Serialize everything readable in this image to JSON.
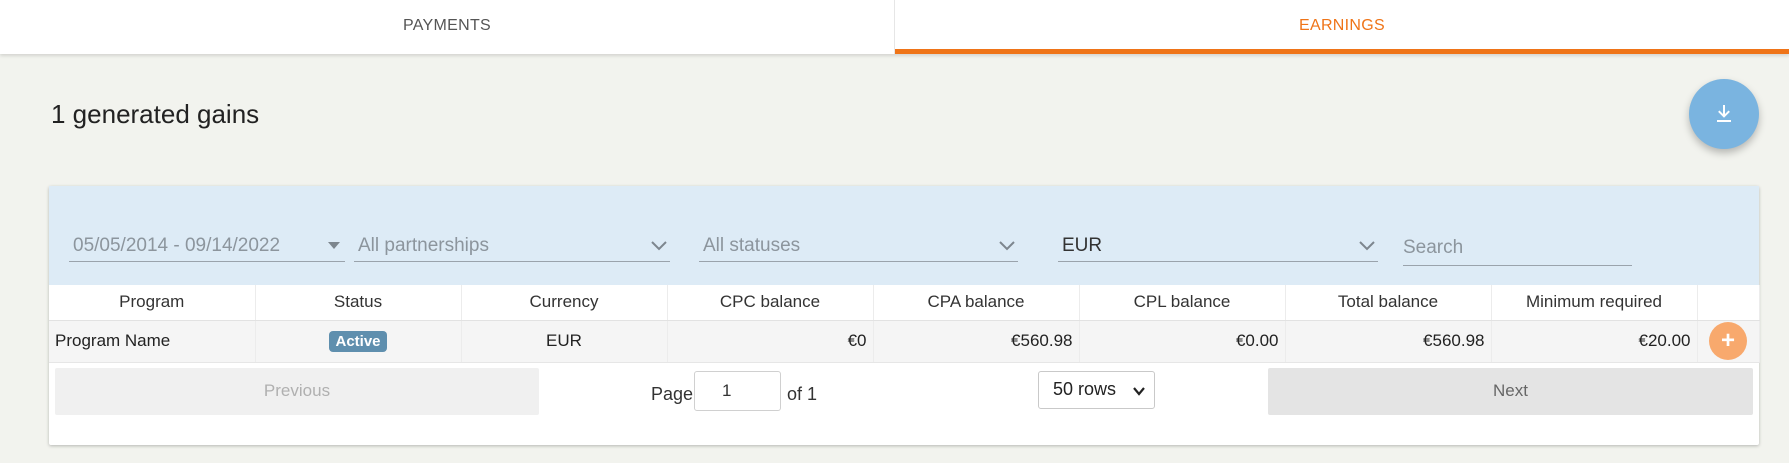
{
  "tabs": [
    {
      "label": "PAYMENTS",
      "active": false
    },
    {
      "label": "EARNINGS",
      "active": true
    }
  ],
  "page": {
    "heading": "1 generated gains",
    "download_icon": "download-icon"
  },
  "filters": {
    "date_range": "05/05/2014 - 09/14/2022",
    "partnerships": "All partnerships",
    "statuses": "All statuses",
    "currency": "EUR",
    "search_placeholder": "Search"
  },
  "table": {
    "columns": [
      "Program",
      "Status",
      "Currency",
      "CPC balance",
      "CPA balance",
      "CPL balance",
      "Total balance",
      "Minimum required"
    ],
    "rows": [
      {
        "program": "Program Name",
        "status": "Active",
        "currency": "EUR",
        "cpc": "€0",
        "cpa": "€560.98",
        "cpl": "€0.00",
        "total": "€560.98",
        "minimum": "€20.00",
        "action": "+"
      }
    ]
  },
  "pagination": {
    "previous": "Previous",
    "next": "Next",
    "page_label": "Page",
    "page_value": "1",
    "of_label": "of 1",
    "rows_option": "50 rows"
  },
  "colors": {
    "accent": "#ef7418",
    "fab": "#7ab4e0",
    "badge": "#5f8fae",
    "filter_bg": "#ddebf6"
  }
}
